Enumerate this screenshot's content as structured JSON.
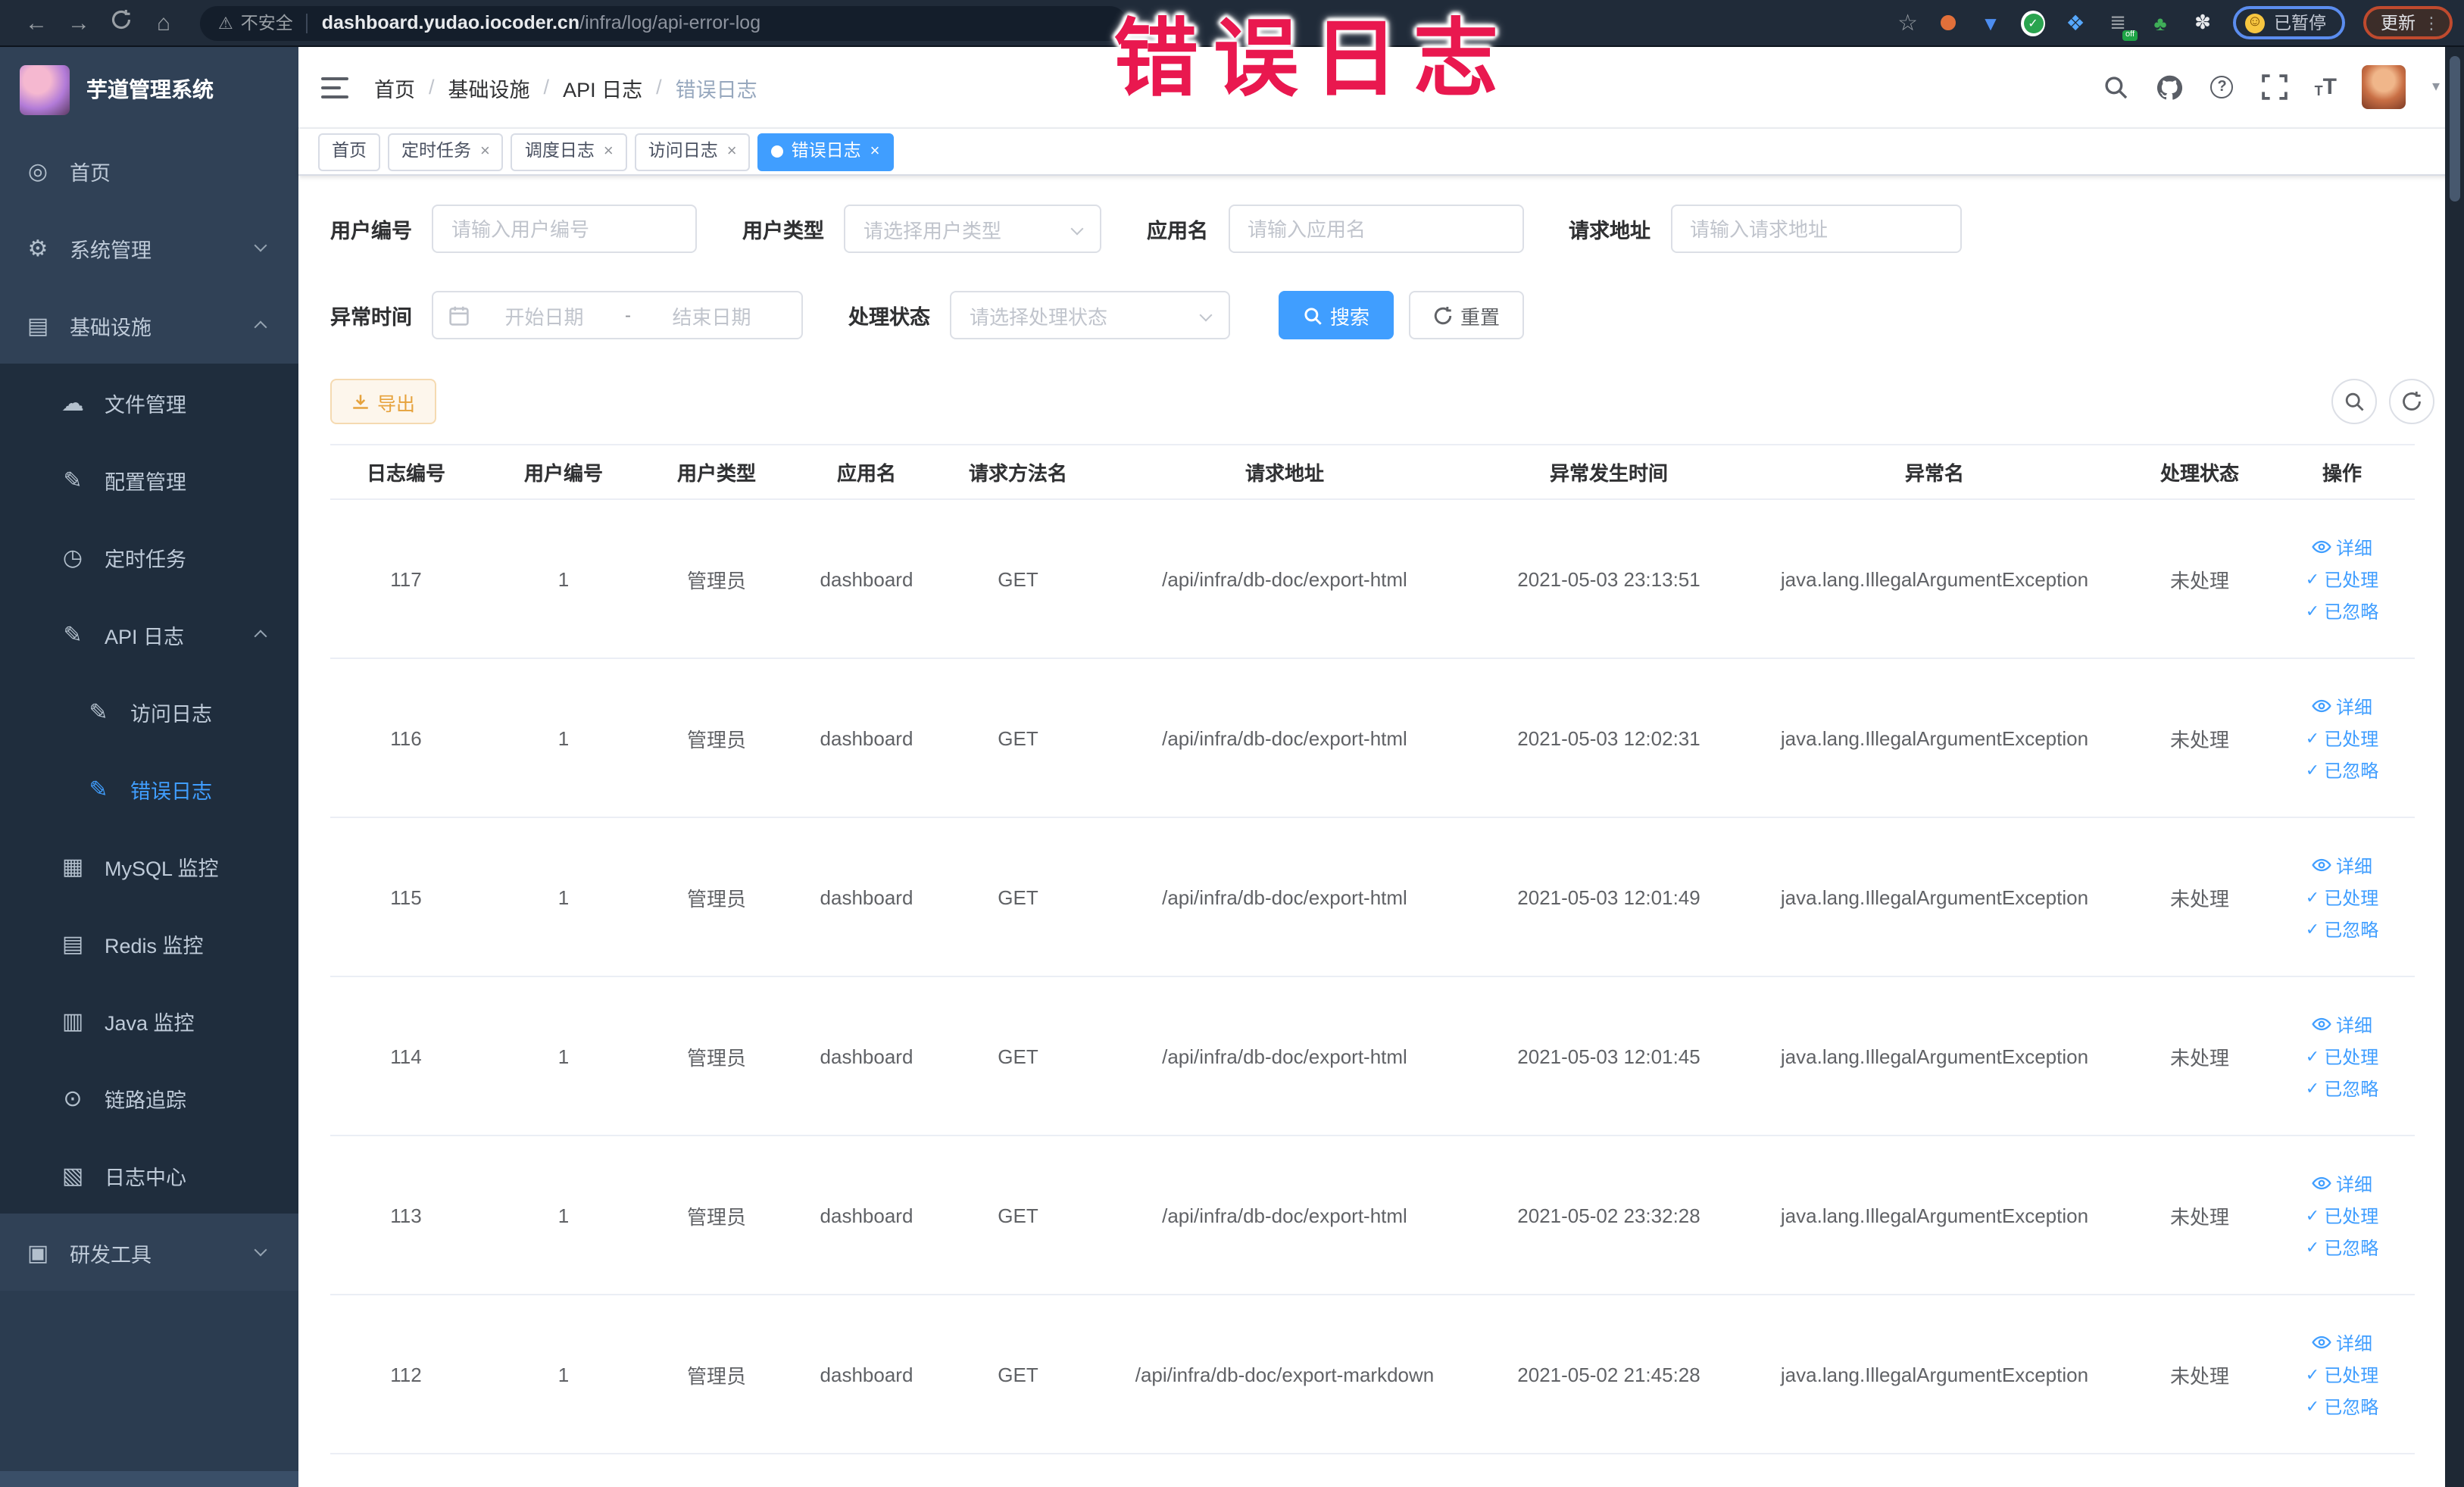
{
  "browser": {
    "security_label": "不安全",
    "url_host": "dashboard.yudao.iocoder.cn",
    "url_path": "/infra/log/api-error-log",
    "paused_badge_label": "已暂停",
    "update_button_label": "更新",
    "off_badge": "off"
  },
  "annotation": {
    "text": "错误日志",
    "color": "#e9184f"
  },
  "icons": {
    "back": "←",
    "forward": "→",
    "home": "⌂",
    "warning": "⚠",
    "star": "☆",
    "kebab": "⋮",
    "caret": "▾",
    "question": "?",
    "font_big": "T",
    "font_small": "T",
    "close": "×",
    "face": "☺",
    "check": "✓",
    "shield": "▼",
    "grid": "❖",
    "lines": "≣",
    "leaf": "♣",
    "puzzle": "✽"
  },
  "sidebar": {
    "title": "芋道管理系统",
    "items": [
      {
        "name": "sidebar-item-home",
        "icon": "dashboard-icon",
        "glyph": "◎",
        "label": "首页"
      },
      {
        "name": "sidebar-item-system-management",
        "icon": "gear-icon",
        "glyph": "⚙",
        "label": "系统管理",
        "chevron_down": true
      },
      {
        "name": "sidebar-item-infrastructure",
        "icon": "infrastructure-icon",
        "glyph": "▤",
        "label": "基础设施",
        "chevron_up": true
      },
      {
        "name": "sidebar-item-file-management",
        "icon": "cloud-upload-icon",
        "glyph": "☁",
        "label": "文件管理",
        "dark": true,
        "ind2": true
      },
      {
        "name": "sidebar-item-config-management",
        "icon": "edit-icon",
        "glyph": "✎",
        "label": "配置管理",
        "dark": true,
        "ind2": true
      },
      {
        "name": "sidebar-item-cron-jobs",
        "icon": "clock-icon",
        "glyph": "◷",
        "label": "定时任务",
        "dark": true,
        "ind2": true
      },
      {
        "name": "sidebar-item-api-log",
        "icon": "document-edit-icon",
        "glyph": "✎",
        "label": "API 日志",
        "dark": true,
        "ind2": true,
        "chevron_up": true
      },
      {
        "name": "sidebar-item-access-log",
        "icon": "edit-icon",
        "glyph": "✎",
        "label": "访问日志",
        "dark": true,
        "ind3": true
      },
      {
        "name": "sidebar-item-error-log",
        "icon": "edit-icon",
        "glyph": "✎",
        "label": "错误日志",
        "dark": true,
        "ind3": true,
        "active": true
      },
      {
        "name": "sidebar-item-mysql-monitor",
        "icon": "chart-icon",
        "glyph": "▦",
        "label": "MySQL 监控",
        "dark": true,
        "ind2": true
      },
      {
        "name": "sidebar-item-redis-monitor",
        "icon": "database-icon",
        "glyph": "▤",
        "label": "Redis 监控",
        "dark": true,
        "ind2": true
      },
      {
        "name": "sidebar-item-java-monitor",
        "icon": "monitor-icon",
        "glyph": "▥",
        "label": "Java 监控",
        "dark": true,
        "ind2": true
      },
      {
        "name": "sidebar-item-tracing",
        "icon": "eye-icon",
        "glyph": "⊙",
        "label": "链路追踪",
        "dark": true,
        "ind2": true
      },
      {
        "name": "sidebar-item-log-center",
        "icon": "log-icon",
        "glyph": "▧",
        "label": "日志中心",
        "dark": true,
        "ind2": true
      },
      {
        "name": "sidebar-item-dev-tools",
        "icon": "toolbox-icon",
        "glyph": "▣",
        "label": "研发工具",
        "chevron_down": true
      }
    ]
  },
  "breadcrumb": {
    "items": [
      "首页",
      "基础设施",
      "API 日志",
      "错误日志"
    ],
    "separator": "/"
  },
  "tabs": [
    {
      "label": "首页"
    },
    {
      "label": "定时任务",
      "closable": true
    },
    {
      "label": "调度日志",
      "closable": true
    },
    {
      "label": "访问日志",
      "closable": true
    },
    {
      "label": "错误日志",
      "closable": true,
      "active": true
    }
  ],
  "filters": {
    "user_id": {
      "label": "用户编号",
      "placeholder": "请输入用户编号"
    },
    "user_type": {
      "label": "用户类型",
      "placeholder": "请选择用户类型"
    },
    "app_name": {
      "label": "应用名",
      "placeholder": "请输入应用名"
    },
    "request_url": {
      "label": "请求地址",
      "placeholder": "请输入请求地址"
    },
    "exception_time": {
      "label": "异常时间",
      "start_placeholder": "开始日期",
      "separator": "-",
      "end_placeholder": "结束日期"
    },
    "process_status": {
      "label": "处理状态",
      "placeholder": "请选择处理状态"
    },
    "search_label": "搜索",
    "reset_label": "重置"
  },
  "toolbar": {
    "export_label": "导出"
  },
  "table": {
    "columns": [
      "日志编号",
      "用户编号",
      "用户类型",
      "应用名",
      "请求方法名",
      "请求地址",
      "异常发生时间",
      "异常名",
      "处理状态",
      "操作"
    ],
    "actions": [
      "详细",
      "已处理",
      "已忽略"
    ],
    "rows": [
      {
        "id": 117,
        "user_id": 1,
        "user_type": "管理员",
        "app_name": "dashboard",
        "method": "GET",
        "url": "/api/infra/db-doc/export-html",
        "time": "2021-05-03 23:13:51",
        "exception": "java.lang.IllegalArgumentException",
        "status": "未处理"
      },
      {
        "id": 116,
        "user_id": 1,
        "user_type": "管理员",
        "app_name": "dashboard",
        "method": "GET",
        "url": "/api/infra/db-doc/export-html",
        "time": "2021-05-03 12:02:31",
        "exception": "java.lang.IllegalArgumentException",
        "status": "未处理"
      },
      {
        "id": 115,
        "user_id": 1,
        "user_type": "管理员",
        "app_name": "dashboard",
        "method": "GET",
        "url": "/api/infra/db-doc/export-html",
        "time": "2021-05-03 12:01:49",
        "exception": "java.lang.IllegalArgumentException",
        "status": "未处理"
      },
      {
        "id": 114,
        "user_id": 1,
        "user_type": "管理员",
        "app_name": "dashboard",
        "method": "GET",
        "url": "/api/infra/db-doc/export-html",
        "time": "2021-05-03 12:01:45",
        "exception": "java.lang.IllegalArgumentException",
        "status": "未处理"
      },
      {
        "id": 113,
        "user_id": 1,
        "user_type": "管理员",
        "app_name": "dashboard",
        "method": "GET",
        "url": "/api/infra/db-doc/export-html",
        "time": "2021-05-02 23:32:28",
        "exception": "java.lang.IllegalArgumentException",
        "status": "未处理"
      },
      {
        "id": 112,
        "user_id": 1,
        "user_type": "管理员",
        "app_name": "dashboard",
        "method": "GET",
        "url": "/api/infra/db-doc/export-markdown",
        "time": "2021-05-02 21:45:28",
        "exception": "java.lang.IllegalArgumentException",
        "status": "未处理"
      }
    ]
  },
  "theme": {
    "primary": "#409eff",
    "warning": "#e6a23c",
    "sidebar_bg": "#304156",
    "submenu_bg": "#1f2d3d"
  }
}
